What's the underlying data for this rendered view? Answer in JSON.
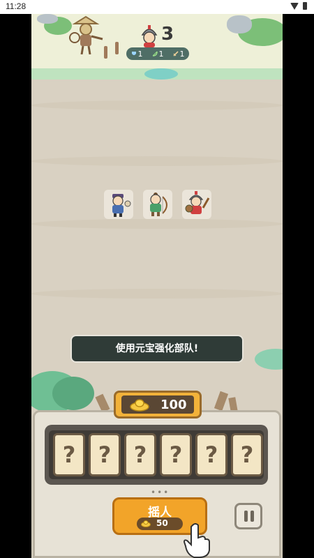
{
  "status_bar": {
    "time": "11:28",
    "icons": [
      "wifi-icon",
      "battery-icon"
    ]
  },
  "enemy": {
    "count": "3",
    "stats": [
      {
        "icon": "shield-icon",
        "value": "1"
      },
      {
        "icon": "bow-icon",
        "value": "1"
      },
      {
        "icon": "sword-icon",
        "value": "1"
      }
    ]
  },
  "units": [
    {
      "name": "bandit",
      "icon": "bandit-icon"
    },
    {
      "name": "archer",
      "icon": "archer-icon"
    },
    {
      "name": "warrior",
      "icon": "warrior-icon"
    }
  ],
  "toast": {
    "text": "使用元宝强化部队!"
  },
  "gold": {
    "value": "100",
    "icon": "gold-ingot-icon"
  },
  "slots": [
    "?",
    "?",
    "?",
    "?",
    "?",
    "?"
  ],
  "recruit_button": {
    "label": "摇人",
    "cost": "50"
  },
  "pause_button": {
    "icon": "pause-icon"
  },
  "colors": {
    "accent": "#f2a429",
    "panel": "#e7e2d6",
    "ground": "#d9d1c2",
    "toast_bg": "#2f3b37"
  }
}
